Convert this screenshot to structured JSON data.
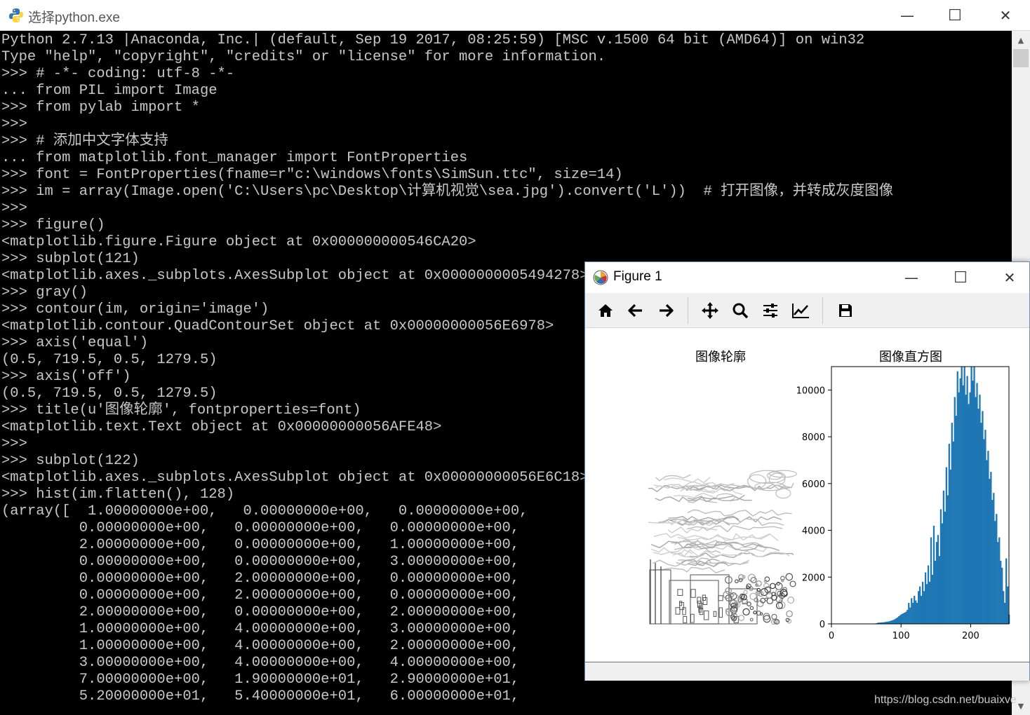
{
  "console_window": {
    "title": "选择python.exe",
    "lines": [
      "Python 2.7.13 |Anaconda, Inc.| (default, Sep 19 2017, 08:25:59) [MSC v.1500 64 bit (AMD64)] on win32",
      "Type \"help\", \"copyright\", \"credits\" or \"license\" for more information.",
      ">>> # -*- coding: utf-8 -*-",
      "... from PIL import Image",
      ">>> from pylab import *",
      ">>>",
      ">>> # 添加中文字体支持",
      "... from matplotlib.font_manager import FontProperties",
      ">>> font = FontProperties(fname=r\"c:\\windows\\fonts\\SimSun.ttc\", size=14)",
      ">>> im = array(Image.open('C:\\Users\\pc\\Desktop\\计算机视觉\\sea.jpg').convert('L'))  # 打开图像，并转成灰度图像",
      ">>>",
      ">>> figure()",
      "<matplotlib.figure.Figure object at 0x000000000546CA20>",
      ">>> subplot(121)",
      "<matplotlib.axes._subplots.AxesSubplot object at 0x0000000005494278>",
      ">>> gray()",
      ">>> contour(im, origin='image')",
      "<matplotlib.contour.QuadContourSet object at 0x00000000056E6978>",
      ">>> axis('equal')",
      "(0.5, 719.5, 0.5, 1279.5)",
      ">>> axis('off')",
      "(0.5, 719.5, 0.5, 1279.5)",
      ">>> title(u'图像轮廓', fontproperties=font)",
      "<matplotlib.text.Text object at 0x00000000056AFE48>",
      ">>>",
      ">>> subplot(122)",
      "<matplotlib.axes._subplots.AxesSubplot object at 0x00000000056E6C18>",
      ">>> hist(im.flatten(), 128)",
      "(array([  1.00000000e+00,   0.00000000e+00,   0.00000000e+00,",
      "         0.00000000e+00,   0.00000000e+00,   0.00000000e+00,",
      "         2.00000000e+00,   0.00000000e+00,   1.00000000e+00,",
      "         0.00000000e+00,   0.00000000e+00,   3.00000000e+00,",
      "         0.00000000e+00,   2.00000000e+00,   0.00000000e+00,",
      "         0.00000000e+00,   2.00000000e+00,   0.00000000e+00,",
      "         2.00000000e+00,   0.00000000e+00,   2.00000000e+00,",
      "         1.00000000e+00,   4.00000000e+00,   3.00000000e+00,",
      "         1.00000000e+00,   4.00000000e+00,   2.00000000e+00,",
      "         3.00000000e+00,   4.00000000e+00,   4.00000000e+00,",
      "         7.00000000e+00,   1.90000000e+01,   2.90000000e+01,",
      "         5.20000000e+01,   5.40000000e+01,   6.00000000e+01,"
    ],
    "minimize_glyph": "—",
    "maximize_glyph": "☐",
    "close_glyph": "✕"
  },
  "figure_window": {
    "title": "Figure 1",
    "minimize_glyph": "—",
    "maximize_glyph": "☐",
    "close_glyph": "✕",
    "toolbar": [
      {
        "name": "home",
        "icon": "home-icon"
      },
      {
        "name": "back",
        "icon": "arrow-left-icon"
      },
      {
        "name": "forward",
        "icon": "arrow-right-icon"
      },
      {
        "name": "pan",
        "icon": "move-icon"
      },
      {
        "name": "zoom",
        "icon": "magnifier-icon"
      },
      {
        "name": "configure-subplots",
        "icon": "sliders-icon"
      },
      {
        "name": "edit-axis",
        "icon": "line-chart-icon"
      },
      {
        "name": "save",
        "icon": "floppy-disk-icon"
      }
    ]
  },
  "contour_subplot": {
    "title": "图像轮廓",
    "axis": "off",
    "colormap": "gray"
  },
  "chart_data": {
    "type": "bar",
    "title": "图像直方图",
    "bins": 128,
    "xlim": [
      0,
      255
    ],
    "ylim": [
      0,
      11000
    ],
    "x_ticks": [
      0,
      100,
      200
    ],
    "y_ticks": [
      0,
      2000,
      4000,
      6000,
      8000,
      10000
    ],
    "bar_color": "#1f77b4",
    "x": [
      0,
      2,
      4,
      6,
      8,
      10,
      12,
      14,
      16,
      18,
      20,
      22,
      24,
      26,
      28,
      30,
      32,
      34,
      36,
      38,
      40,
      42,
      44,
      46,
      48,
      50,
      52,
      54,
      56,
      58,
      60,
      62,
      64,
      66,
      68,
      70,
      72,
      74,
      76,
      78,
      80,
      82,
      84,
      86,
      88,
      90,
      92,
      94,
      96,
      98,
      100,
      102,
      104,
      106,
      108,
      110,
      112,
      114,
      116,
      118,
      120,
      122,
      124,
      126,
      128,
      130,
      132,
      134,
      136,
      138,
      140,
      142,
      144,
      146,
      148,
      150,
      152,
      154,
      156,
      158,
      160,
      162,
      164,
      166,
      168,
      170,
      172,
      174,
      176,
      178,
      180,
      182,
      184,
      186,
      188,
      190,
      192,
      194,
      196,
      198,
      200,
      202,
      204,
      206,
      208,
      210,
      212,
      214,
      216,
      218,
      220,
      222,
      224,
      226,
      228,
      230,
      232,
      234,
      236,
      238,
      240,
      242,
      244,
      246,
      248,
      250,
      252,
      254
    ],
    "values": [
      1,
      0,
      0,
      0,
      0,
      0,
      2,
      0,
      1,
      0,
      0,
      3,
      0,
      2,
      0,
      0,
      2,
      0,
      2,
      0,
      2,
      1,
      4,
      3,
      1,
      4,
      2,
      3,
      4,
      4,
      7,
      19,
      29,
      52,
      54,
      60,
      65,
      70,
      80,
      90,
      100,
      110,
      130,
      150,
      170,
      200,
      240,
      280,
      330,
      380,
      420,
      450,
      480,
      520,
      600,
      900,
      700,
      1100,
      900,
      1200,
      1000,
      900,
      1400,
      1600,
      1200,
      1800,
      1400,
      2200,
      1700,
      2500,
      1800,
      3700,
      2100,
      4200,
      2700,
      3500,
      3800,
      2900,
      4900,
      4300,
      5700,
      4800,
      6700,
      5500,
      7700,
      6600,
      8600,
      7800,
      9700,
      8900,
      10800,
      9900,
      10500,
      11000,
      10200,
      11000,
      9800,
      10600,
      9400,
      9900,
      11000,
      10400,
      11000,
      9700,
      10300,
      9200,
      9800,
      8600,
      9100,
      7900,
      8300,
      7000,
      7400,
      6200,
      6500,
      5300,
      5600,
      4400,
      4700,
      3500,
      3700,
      2700,
      2400,
      1400,
      900,
      2800,
      1600,
      400
    ]
  },
  "watermark": "https://blog.csdn.net/buaixve"
}
